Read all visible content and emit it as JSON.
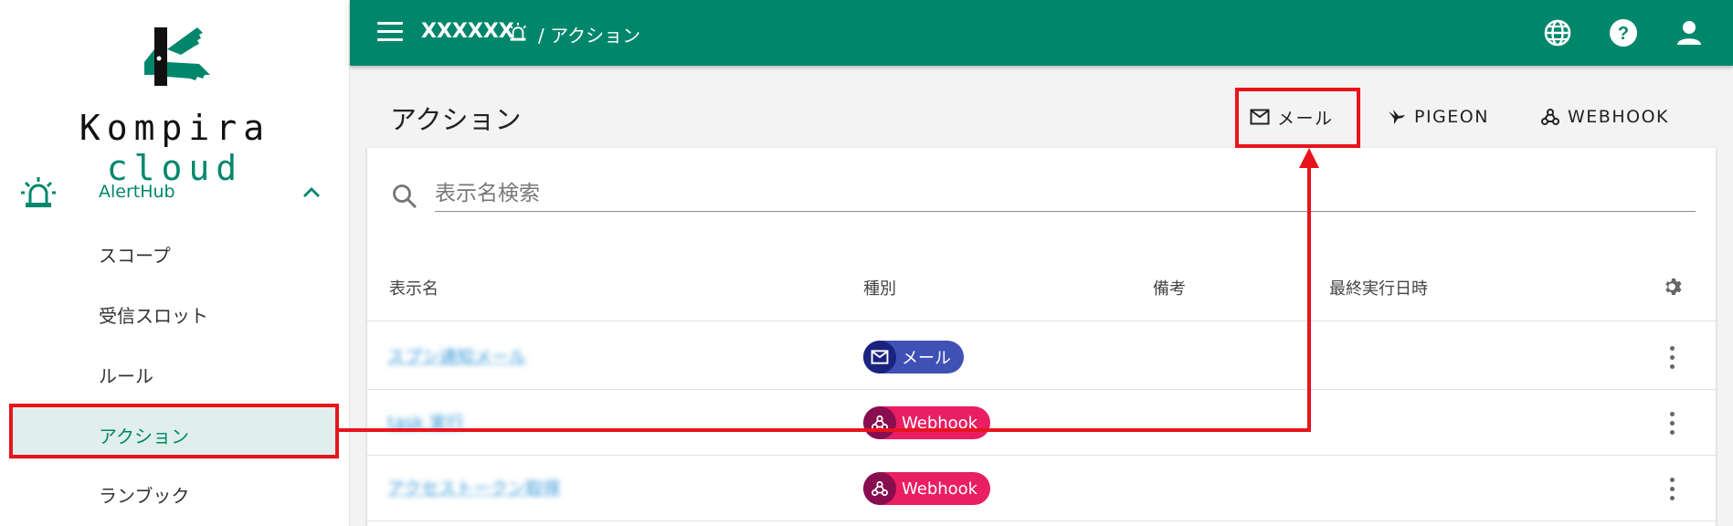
{
  "sidebar": {
    "logo": {
      "text_main": "Kompira",
      "text_accent": "cloud"
    },
    "group": {
      "label": "AlertHub",
      "icon": "alarm-light-icon",
      "expanded": true
    },
    "items": [
      {
        "label": "スコープ"
      },
      {
        "label": "受信スロット"
      },
      {
        "label": "ルール"
      },
      {
        "label": "アクション",
        "active": true
      },
      {
        "label": "ランブック"
      }
    ]
  },
  "header": {
    "org_name": "XXXXXX",
    "breadcrumb_icon": "alarm-light-icon",
    "breadcrumb_sep": "/",
    "breadcrumb_page": "アクション",
    "icons": [
      "globe-icon",
      "help-icon",
      "account-icon"
    ]
  },
  "main": {
    "title": "アクション",
    "create_buttons": [
      {
        "label": "メール",
        "icon": "mail-icon"
      },
      {
        "label": "PIGEON",
        "icon": "pigeon-icon"
      },
      {
        "label": "WEBHOOK",
        "icon": "webhook-icon"
      }
    ],
    "search": {
      "placeholder": "表示名検索",
      "value": ""
    },
    "table": {
      "columns": [
        "表示名",
        "種別",
        "備考",
        "最終実行日時"
      ],
      "rows": [
        {
          "name": "スプシ通知メール",
          "type": "メール",
          "note": "",
          "last_run": ""
        },
        {
          "name": "task 実行",
          "type": "Webhook",
          "note": "",
          "last_run": ""
        },
        {
          "name": "アクセストークン取得",
          "type": "Webhook",
          "note": "",
          "last_run": ""
        }
      ]
    }
  },
  "colors": {
    "primary": "#00876b",
    "active_bg": "#e0efeb",
    "mail_chip": "#3f51b5",
    "webhook_chip": "#e91e63",
    "annotation": "#e8141c"
  }
}
